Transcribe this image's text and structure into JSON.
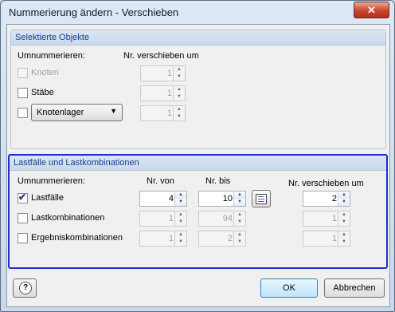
{
  "window": {
    "title": "Nummerierung ändern - Verschieben",
    "close_glyph": "✕"
  },
  "group1": {
    "title": "Selektierte Objekte",
    "col_renumber": "Umnummerieren:",
    "col_shift": "Nr. verschieben  um",
    "rows": [
      {
        "label": "Knoten",
        "checked": false,
        "enabled": false,
        "shift": "1"
      },
      {
        "label": "Stäbe",
        "checked": false,
        "enabled": true,
        "shift": "1"
      },
      {
        "label": "Knotenlager",
        "checked": false,
        "enabled": true,
        "shift": "1"
      }
    ]
  },
  "group2": {
    "title": "Lastfälle und Lastkombinationen",
    "col_renumber": "Umnummerieren:",
    "col_from": "Nr. von",
    "col_to": "Nr. bis",
    "col_shift": "Nr. verschieben  um",
    "rows": [
      {
        "label": "Lastfälle",
        "checked": true,
        "from": "4",
        "to": "10",
        "shift": "2"
      },
      {
        "label": "Lastkombinationen",
        "checked": false,
        "from": "1",
        "to": "94",
        "shift": "1"
      },
      {
        "label": "Ergebniskombinationen",
        "checked": false,
        "from": "1",
        "to": "2",
        "shift": "1"
      }
    ]
  },
  "footer": {
    "help_glyph": "?",
    "ok_label": "OK",
    "cancel_label": "Abbrechen"
  },
  "glyphs": {
    "check": "✔",
    "up": "▲",
    "down": "▼",
    "combo_arrow": "▼"
  }
}
